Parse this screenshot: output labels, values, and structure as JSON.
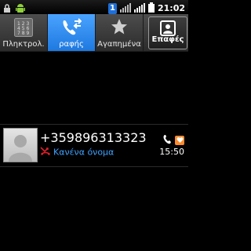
{
  "status_bar": {
    "time": "21:02",
    "sim_number": "1"
  },
  "tabs": [
    {
      "label": "Πληκτρολ.",
      "icon": "keypad-icon",
      "selected": false
    },
    {
      "label": "ραφής",
      "icon": "call-log-icon",
      "selected": true
    },
    {
      "label": "Αγαπημένα",
      "icon": "star-icon",
      "selected": false
    },
    {
      "label": "Επαφές",
      "icon": "contacts-icon",
      "selected": false
    }
  ],
  "call_log": {
    "entries": [
      {
        "number": "+359896313323",
        "name": "Κανένα όνομα",
        "time": "15:50",
        "call_type": "missed-call"
      }
    ]
  },
  "colors": {
    "accent": "#1e79e0",
    "name_text": "#3ea2ff",
    "missed": "#e0202a",
    "sms_badge": "#ff8a2b"
  }
}
